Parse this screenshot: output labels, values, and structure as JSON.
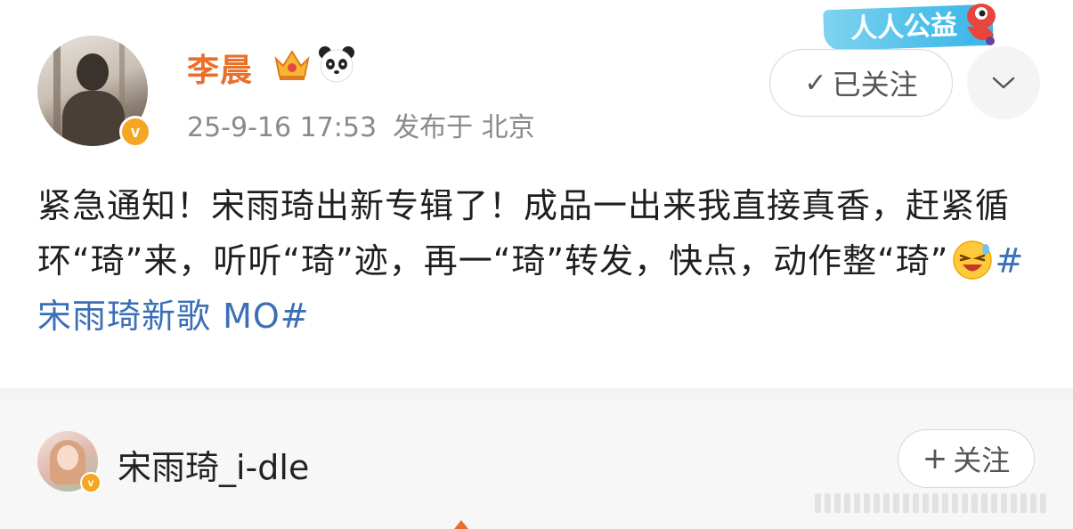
{
  "post": {
    "author": {
      "name": "李晨",
      "badges": [
        "crown-icon",
        "panda-icon"
      ],
      "verified_icon": "v"
    },
    "timestamp": "25-9-16 17:53",
    "location": "发布于 北京",
    "charity_badge": "人人公益",
    "follow_button": "已关注",
    "content": {
      "text": "紧急通知！宋雨琦出新专辑了！成品一出来我直接真香，赶紧循环“琦”来，听听“琦”迹，再一“琦”转发，快点，动作整“琦”",
      "emoji": "laugh-emoji",
      "hashtag": "#宋雨琦新歌 MO#"
    }
  },
  "repost": {
    "author": {
      "name": "宋雨琦_i-dle",
      "verified_icon": "v"
    },
    "follow_button": "关注"
  },
  "colors": {
    "username": "#e8702a",
    "hashtag": "#3b6fb6",
    "meta": "#8a8a8a",
    "verified": "#f5a623"
  }
}
